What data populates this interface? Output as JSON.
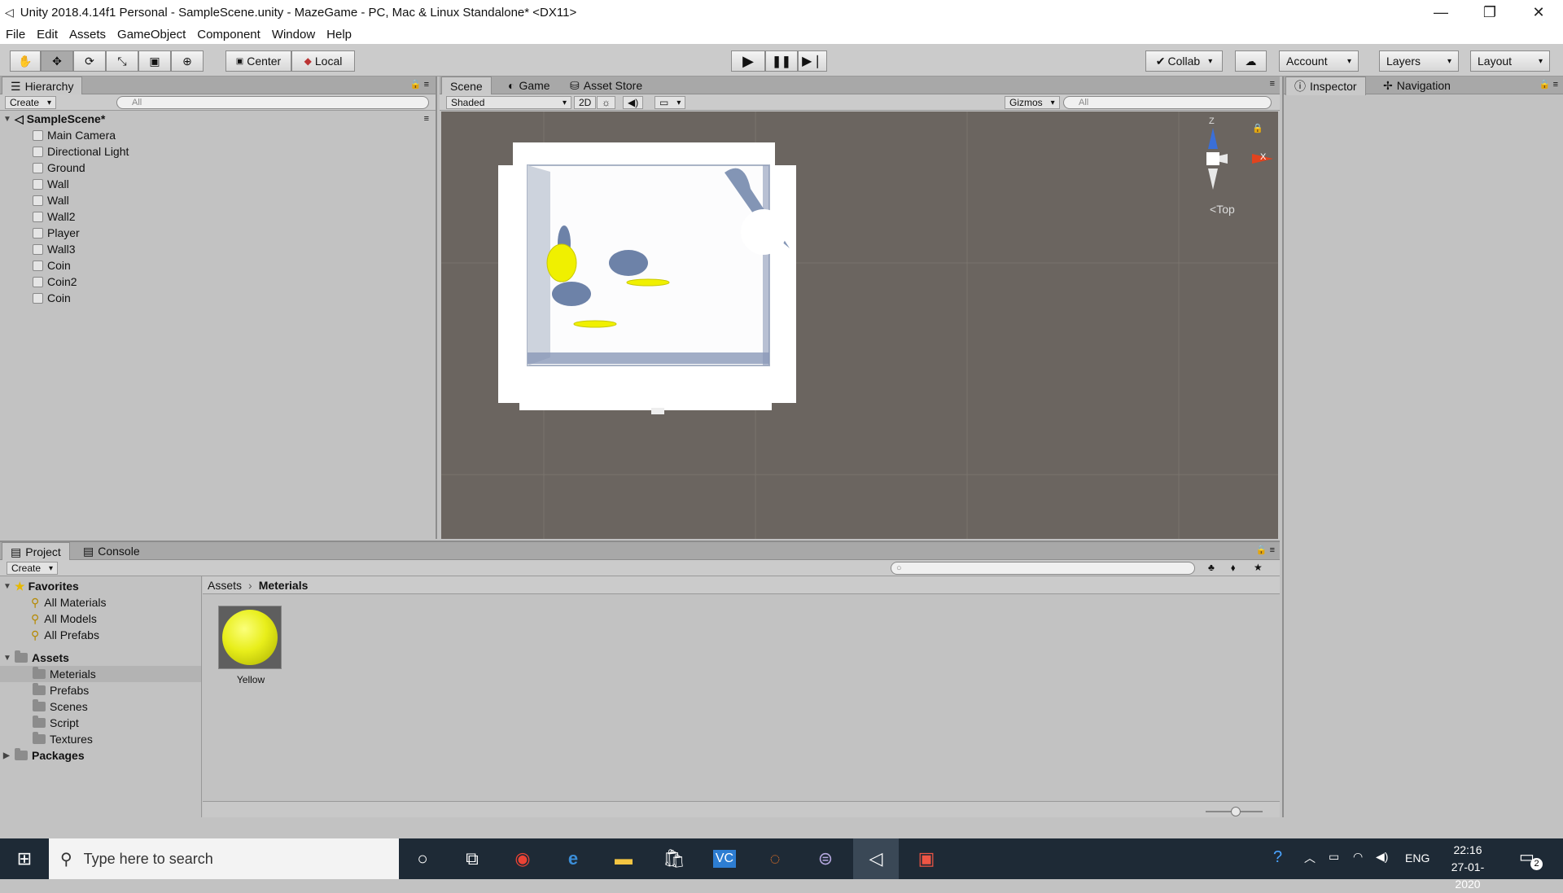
{
  "window": {
    "title": "Unity 2018.4.14f1 Personal - SampleScene.unity - MazeGame - PC, Mac & Linux Standalone* <DX11>",
    "controls": [
      "—",
      "❐",
      "✕"
    ]
  },
  "menu": [
    "File",
    "Edit",
    "Assets",
    "GameObject",
    "Component",
    "Window",
    "Help"
  ],
  "toolbar": {
    "pivot": "Center",
    "space": "Local",
    "collab": "Collab",
    "account": "Account",
    "layers": "Layers",
    "layout": "Layout"
  },
  "hierarchy": {
    "tab": "Hierarchy",
    "create": "Create",
    "search_placeholder": "All",
    "scene": "SampleScene*",
    "items": [
      "Main Camera",
      "Directional Light",
      "Ground",
      "Wall",
      "Wall",
      "Wall2",
      "Player",
      "Wall3",
      "Coin",
      "Coin2",
      "Coin"
    ]
  },
  "scene_view": {
    "tabs": [
      "Scene",
      "Game",
      "Asset Store"
    ],
    "shading": "Shaded",
    "mode_2d": "2D",
    "gizmos": "Gizmos",
    "search_placeholder": "All",
    "gizmo_axes": {
      "z": "Z",
      "x": "X"
    },
    "view_label": "Top"
  },
  "inspector": {
    "tabs": [
      "Inspector",
      "Navigation"
    ]
  },
  "project": {
    "tabs": [
      "Project",
      "Console"
    ],
    "create": "Create",
    "favorites_label": "Favorites",
    "favorites": [
      "All Materials",
      "All Models",
      "All Prefabs"
    ],
    "assets_label": "Assets",
    "asset_folders": [
      "Meterials",
      "Prefabs",
      "Scenes",
      "Script",
      "Textures"
    ],
    "packages_label": "Packages",
    "breadcrumb": [
      "Assets",
      "Meterials"
    ],
    "assets": [
      {
        "name": "Yellow",
        "color": "#e8ee1a"
      }
    ]
  },
  "taskbar": {
    "search_placeholder": "Type here to search",
    "language": "ENG",
    "time": "22:16",
    "date": "27-01-2020",
    "notification_count": "2"
  },
  "colors": {
    "scene_bg": "#6b6560",
    "taskbar": "#1e2a36",
    "selected_row": "#b3b3b3",
    "coin": "#f0f000"
  }
}
